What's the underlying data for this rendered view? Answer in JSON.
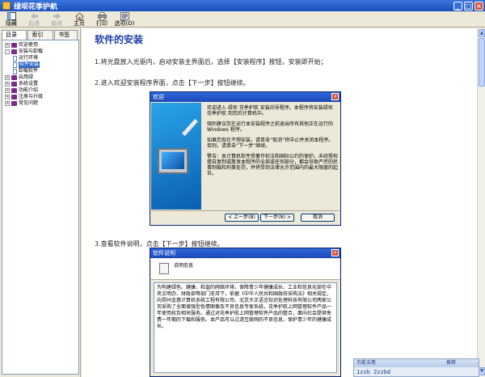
{
  "window": {
    "title": "绿坝花季护航"
  },
  "toolbar": [
    {
      "label": "隐藏",
      "icon": "hide-pane-icon",
      "enabled": true
    },
    {
      "label": "后退",
      "icon": "back-icon",
      "enabled": false
    },
    {
      "label": "前进",
      "icon": "forward-icon",
      "enabled": false
    },
    {
      "label": "主页",
      "icon": "home-icon",
      "enabled": true
    },
    {
      "label": "打印",
      "icon": "print-icon",
      "enabled": true
    },
    {
      "label": "选项(O)",
      "icon": "options-icon",
      "enabled": true
    }
  ],
  "nav": {
    "tabs": [
      "目录(C)",
      "索引(N)",
      "书签(I)"
    ],
    "tree": [
      {
        "label": "欢迎使用",
        "type": "book",
        "level": 0,
        "expander": "+"
      },
      {
        "label": "安装与卸载",
        "type": "book",
        "level": 0,
        "expander": "-"
      },
      {
        "label": "运行环境",
        "type": "page",
        "level": 1
      },
      {
        "label": "软件安装",
        "type": "page",
        "level": 1,
        "selected": true
      },
      {
        "label": "卸载软件",
        "type": "page",
        "level": 1
      },
      {
        "label": "启用绿",
        "type": "book",
        "level": 0,
        "expander": "+"
      },
      {
        "label": "系统设置",
        "type": "book",
        "level": 0,
        "expander": "+"
      },
      {
        "label": "功能介绍",
        "type": "book",
        "level": 0,
        "expander": "+"
      },
      {
        "label": "注册与升级",
        "type": "book",
        "level": 0,
        "expander": "+"
      },
      {
        "label": "常见问题",
        "type": "book",
        "level": 0,
        "expander": "+"
      }
    ]
  },
  "content": {
    "title": "软件的安装",
    "step1": "1.将光盘放入光驱内，启动安装主界面后，选择【安装程序】按钮，安装即开始；",
    "step2": "2.进入欢迎安装程序界面，点击【下一步】按钮继续。",
    "step3": "3.查看软件说明，点击【下一步】按钮继续。"
  },
  "dialog1": {
    "title": "欢迎",
    "p1": "欢迎进入 绿坝 花季护航 安装向导程序。本程序将安装绿坝 花季护航 到您的计算机中。",
    "p2": "强烈建议您在运行本安装程序之前退出所有其他正在运行的 Windows 程序。",
    "p3": "如果您现在不想安装，请单击“取消”将中止并关闭本程序。否则，请单击“下一步”继续。",
    "p4": "警告：本计算机软件受著作权法和国际公约的保护。未经授权擅自复制或散发本程序的全部或任何部分，都会导致严厉的民事制裁和刑事处罚，并将受到法律允许范围内的最大限度的起诉。",
    "back": "< 上一步(B)",
    "next": "下一步(N) >",
    "cancel": "取消"
  },
  "dialog2": {
    "title": "软件说明",
    "header": "说明信息",
    "text": "为构建绿色、健康、和谐的网络环境，保障青少年健康成长，工业和信息化部在中央文明办、财政部等部门支持下，依据《中华人民共和国政府采购法》相关规定，向郑州金惠计算机系统工程有限公司、北京大正语言知识处理科技有限公司两家公司采购了全面增强型色情图像及不良信息专家系统，花季护航上网管理软件产品一年使用权及相关服务。通过对花季护航上网管理软件产品的整合，面向社会提供免费一年期的下载和服务。本产品可以过滤互联网的不良信息，保护青少年的健康成长。"
  },
  "widget": {
    "left": "万能五笔",
    "right": "推荐",
    "text": "1zzb 2zzbd"
  }
}
